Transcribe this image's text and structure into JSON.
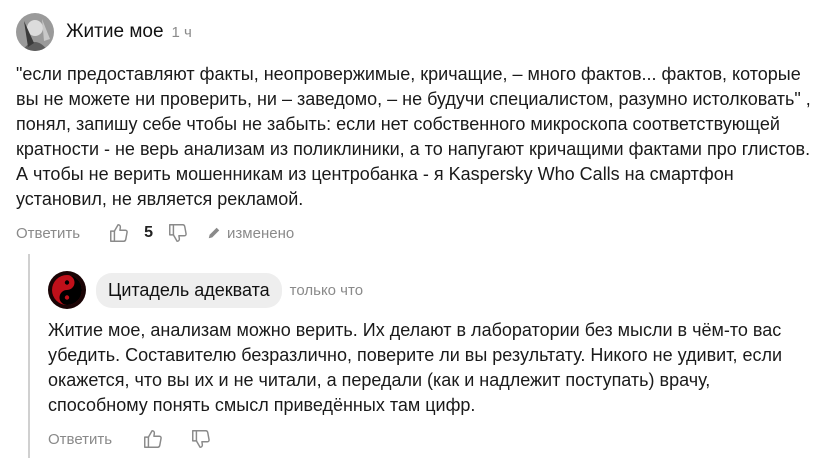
{
  "comment": {
    "author": "Житие мое",
    "time": "1 ч",
    "text": "\"если предоставляют факты, неопровержимые, кричащие, – много фактов... фактов, которые вы не можете ни проверить, ни – заведомо, – не будучи специалистом, разумно истолковать\" , понял, запишу себе чтобы не забыть: если нет собственного микроскопа соответствующей кратности - не верь анализам из поликлиники, а то напугают кричащими фактами про глистов. А чтобы не верить мошенникам из центробанка - я Kaspersky Who Calls на смартфон установил, не является рекламой.",
    "reply_label": "Ответить",
    "likes": "5",
    "edited_label": "изменено"
  },
  "reply": {
    "author": "Цитадель адеквата",
    "time": "только что",
    "text": "Житие мое, анализам можно верить. Их делают в лаборатории без мысли в чём-то вас убедить. Составителю безразлично, поверите ли вы результату. Никого не удивит, если окажется, что вы их и не читали, а передали (как и надлежит поступать) врачу, способному понять смысл приведённых там цифр.",
    "reply_label": "Ответить"
  },
  "icons": {
    "like": "thumbs-up-icon",
    "dislike": "thumbs-down-icon",
    "edit": "pencil-icon"
  },
  "colors": {
    "muted": "#8a8a8a",
    "author_bubble": "#eeeeee",
    "avatar_red": "#c0101a"
  }
}
